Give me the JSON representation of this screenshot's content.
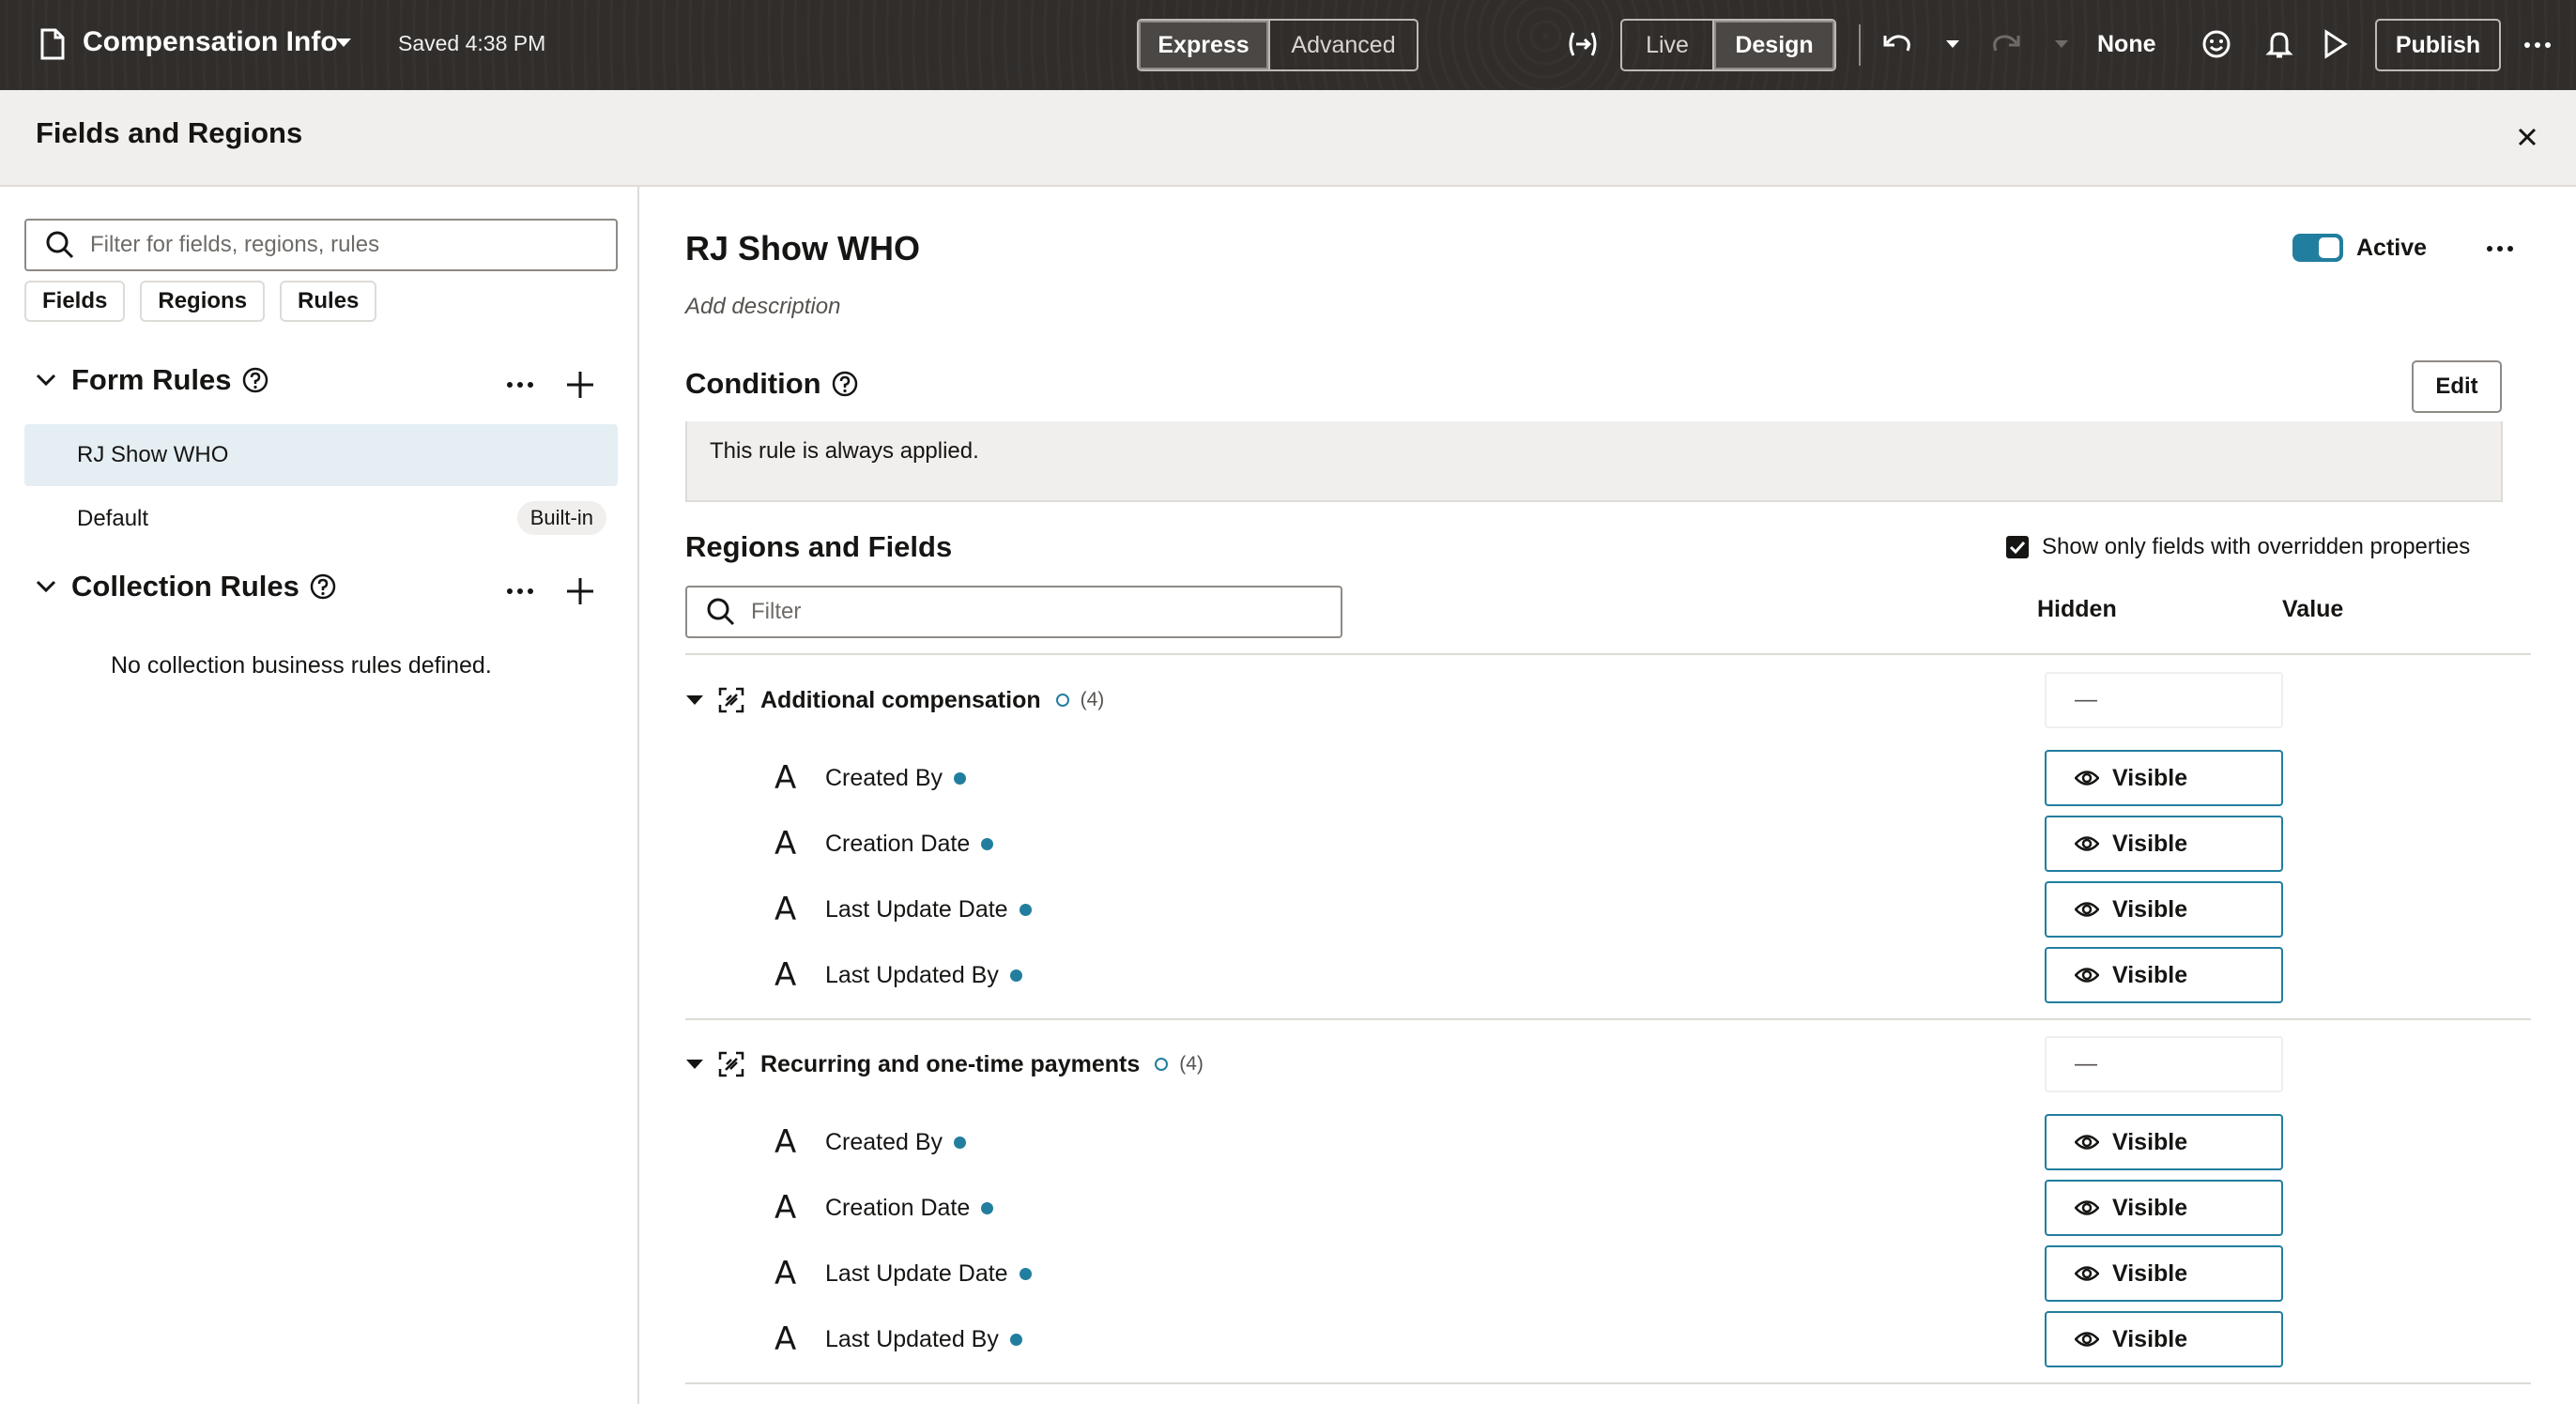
{
  "topbar": {
    "title": "Compensation Info",
    "saved": "Saved 4:38 PM",
    "mode_express": "Express",
    "mode_advanced": "Advanced",
    "view_live": "Live",
    "view_design": "Design",
    "none_label": "None",
    "publish": "Publish"
  },
  "panel": {
    "title": "Fields and Regions"
  },
  "left": {
    "search_placeholder": "Filter for fields, regions, rules",
    "chips": [
      "Fields",
      "Regions",
      "Rules"
    ],
    "form_rules_title": "Form Rules",
    "form_rules": [
      {
        "label": "RJ Show WHO",
        "badge": ""
      },
      {
        "label": "Default",
        "badge": "Built-in"
      }
    ],
    "collection_rules_title": "Collection Rules",
    "collection_empty": "No collection business rules defined."
  },
  "right": {
    "rule_title": "RJ Show WHO",
    "add_description": "Add description",
    "active_label": "Active",
    "condition_title": "Condition",
    "edit_label": "Edit",
    "condition_text": "This rule is always applied.",
    "regions_title": "Regions and Fields",
    "show_only_label": "Show only fields with overridden properties",
    "filter_placeholder": "Filter",
    "col_hidden": "Hidden",
    "col_value": "Value",
    "regions": [
      {
        "name": "Additional compensation",
        "count": "(4)",
        "hidden": "—",
        "fields": [
          {
            "name": "Created By",
            "hidden": "Visible"
          },
          {
            "name": "Creation Date",
            "hidden": "Visible"
          },
          {
            "name": "Last Update Date",
            "hidden": "Visible"
          },
          {
            "name": "Last Updated By",
            "hidden": "Visible"
          }
        ]
      },
      {
        "name": "Recurring and one-time payments",
        "count": "(4)",
        "hidden": "—",
        "fields": [
          {
            "name": "Created By",
            "hidden": "Visible"
          },
          {
            "name": "Creation Date",
            "hidden": "Visible"
          },
          {
            "name": "Last Update Date",
            "hidden": "Visible"
          },
          {
            "name": "Last Updated By",
            "hidden": "Visible"
          }
        ]
      }
    ]
  },
  "colors": {
    "accent": "#227e9e",
    "topbar": "#302d2b",
    "selected_row": "#e4eef3"
  }
}
